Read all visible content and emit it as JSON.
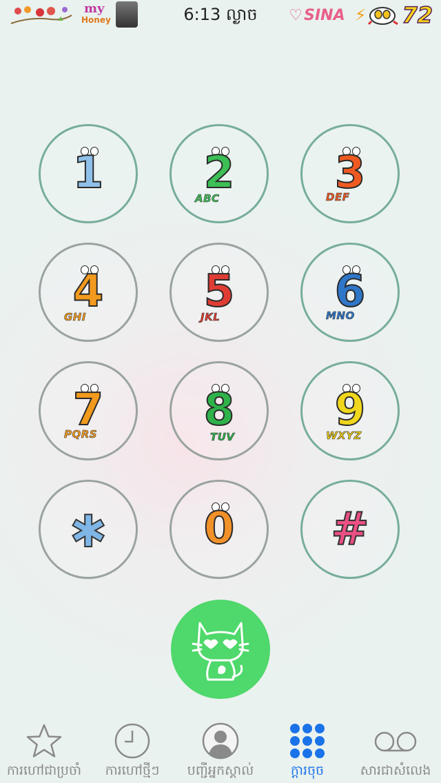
{
  "status_bar": {
    "time": "6:13 ល្ងាច",
    "deco_my": "my",
    "deco_honey": "Honey",
    "carrier": "SINA",
    "battery_level": "72"
  },
  "keypad": {
    "keys": [
      {
        "digit": "1",
        "letters": "",
        "color": "#8fc0ea"
      },
      {
        "digit": "2",
        "letters": "ABC",
        "color": "#3cbf55"
      },
      {
        "digit": "3",
        "letters": "DEF",
        "color": "#ee5a22"
      },
      {
        "digit": "4",
        "letters": "GHI",
        "color": "#f29a1d"
      },
      {
        "digit": "5",
        "letters": "JKL",
        "color": "#df3d34"
      },
      {
        "digit": "6",
        "letters": "MNO",
        "color": "#2f76c8"
      },
      {
        "digit": "7",
        "letters": "PQRS",
        "color": "#f29a1d"
      },
      {
        "digit": "8",
        "letters": "TUV",
        "color": "#2fb24a"
      },
      {
        "digit": "9",
        "letters": "WXYZ",
        "color": "#f0d61c"
      },
      {
        "digit": "0",
        "letters": "",
        "color": "#f2912a"
      }
    ],
    "star_color": "#7fb6e6",
    "hash_color": "#ec4f84"
  },
  "call_button": {
    "icon": "cat-icon",
    "color": "#4fd86b"
  },
  "tab_bar": {
    "tabs": [
      {
        "label": "ការហៅជាប្រចាំ",
        "icon": "star-icon",
        "active": false
      },
      {
        "label": "ការហៅថ្មីៗ",
        "icon": "clock-icon",
        "active": false
      },
      {
        "label": "បញ្ជីអ្នកស្គាល់",
        "icon": "contacts-icon",
        "active": false
      },
      {
        "label": "ក្ដារចុច",
        "icon": "keypad-icon",
        "active": true
      },
      {
        "label": "សារជាសំលេង",
        "icon": "voicemail-icon",
        "active": false
      }
    ],
    "active_color": "#1a73e8"
  }
}
